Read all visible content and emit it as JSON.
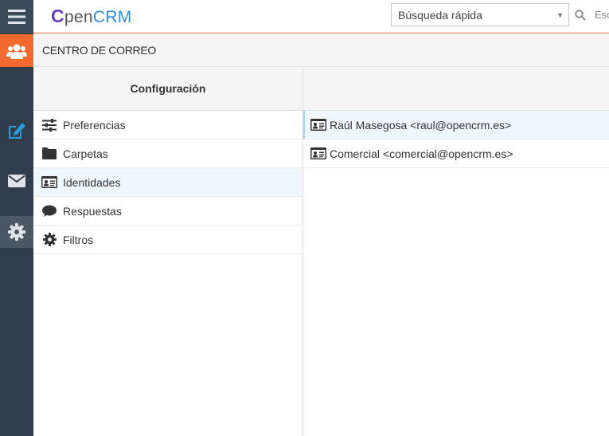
{
  "app": {
    "logo_c": "C",
    "logo_pen": "pen",
    "logo_crm": "CRM"
  },
  "search": {
    "selected": "Búsqueda rápida",
    "placeholder": "Esc"
  },
  "section": {
    "title": "CENTRO DE CORREO"
  },
  "config": {
    "title": "Configuración",
    "items": [
      {
        "label": "Preferencias",
        "icon": "sliders-icon"
      },
      {
        "label": "Carpetas",
        "icon": "folder-icon"
      },
      {
        "label": "Identidades",
        "icon": "id-card-icon"
      },
      {
        "label": "Respuestas",
        "icon": "comment-icon"
      },
      {
        "label": "Filtros",
        "icon": "gear-icon"
      }
    ],
    "active_index": 2
  },
  "identities": [
    {
      "label": "Raúl Masegosa <raul@opencrm.es>"
    },
    {
      "label": "Comercial <comercial@opencrm.es>"
    }
  ],
  "colors": {
    "accent": "#f26a2f",
    "sidebar": "#2f3e4a",
    "link_blue": "#2a8fd8",
    "selected_bg": "#edf7fc"
  }
}
